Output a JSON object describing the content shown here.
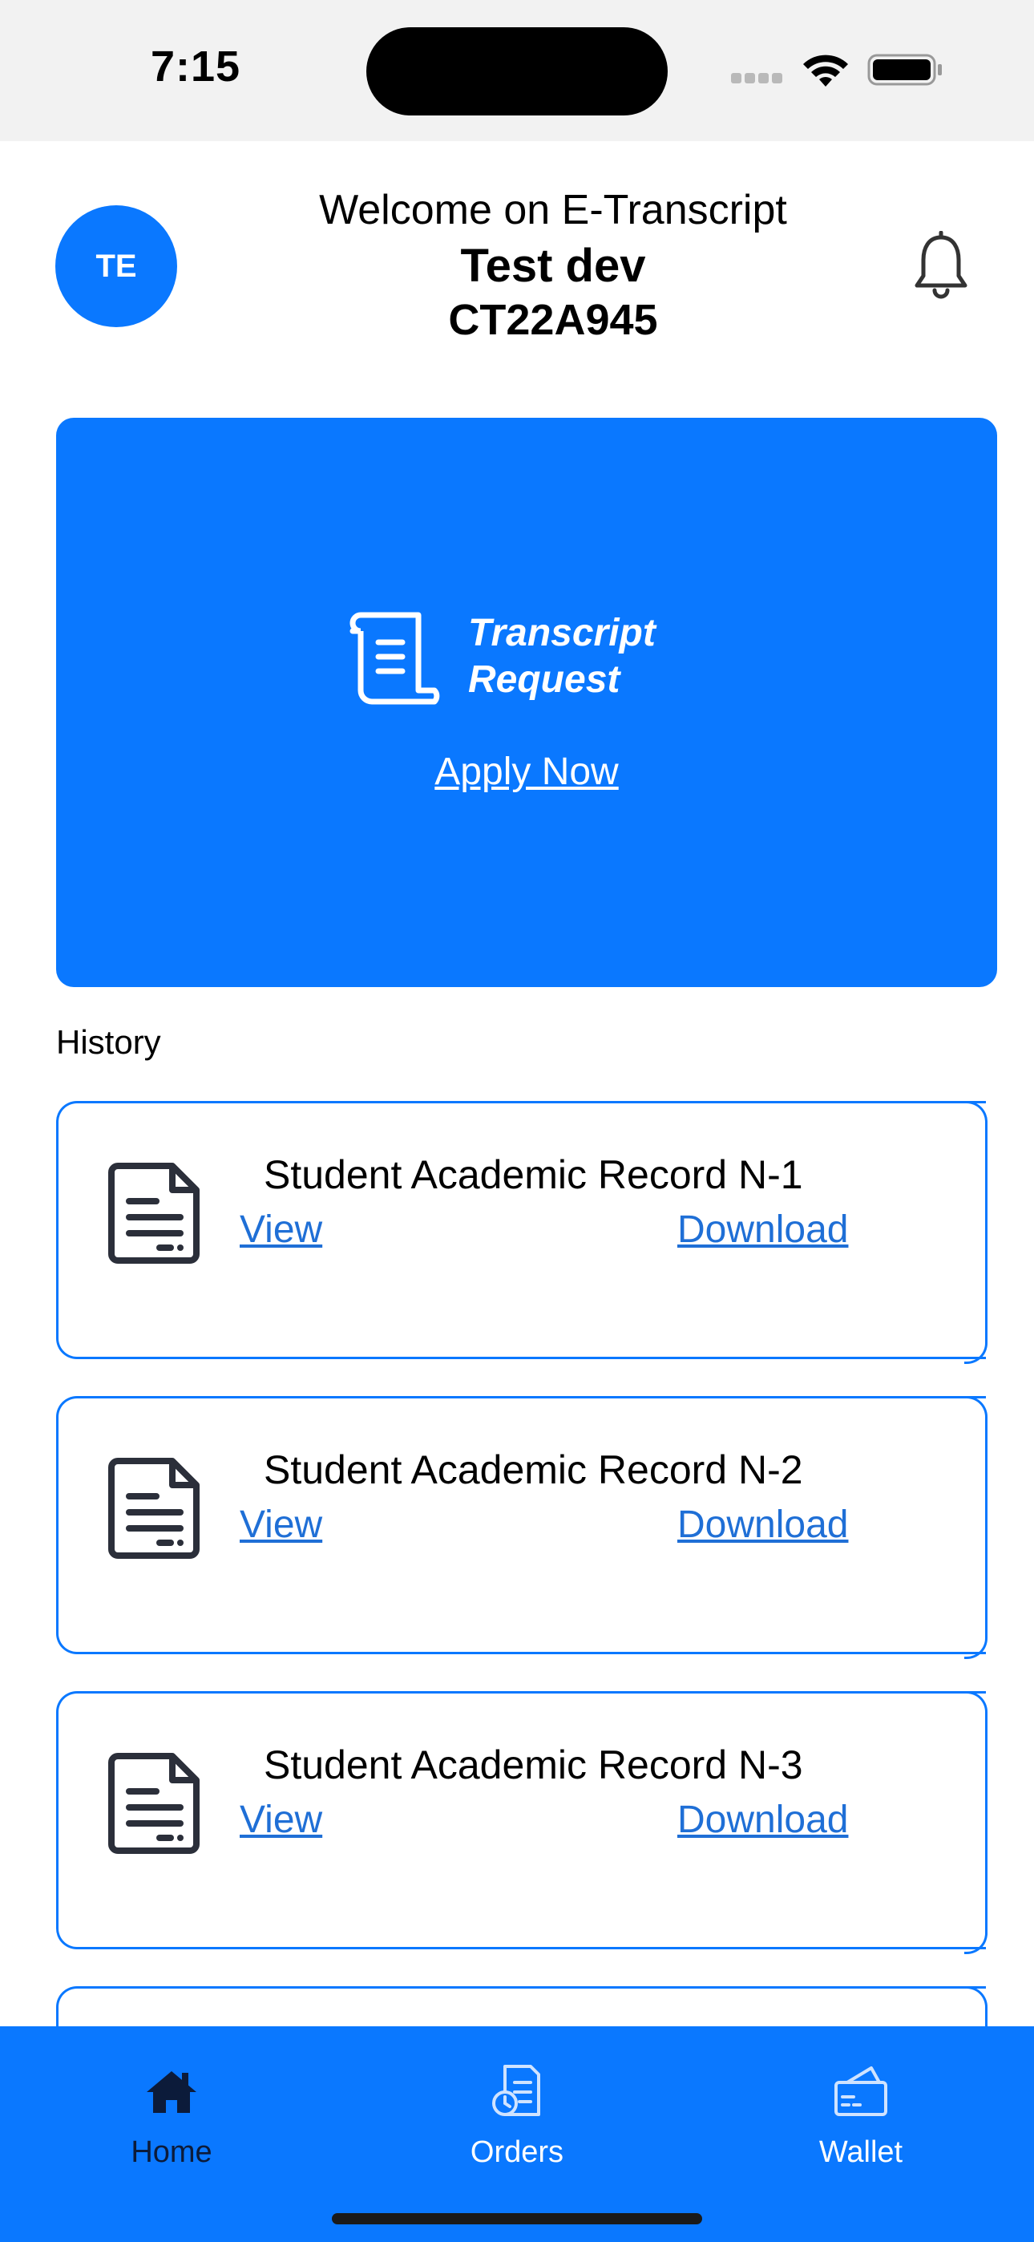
{
  "status_bar": {
    "time": "7:15"
  },
  "header": {
    "avatar_initials": "TE",
    "welcome": "Welcome on E-Transcript",
    "user_name": "Test dev",
    "user_id": "CT22A945"
  },
  "hero": {
    "title_line1": "Transcript",
    "title_line2": "Request",
    "cta": "Apply Now",
    "color": "#0a78ff"
  },
  "history": {
    "label": "History",
    "items": [
      {
        "title": "Student Academic Record N-1",
        "view": "View",
        "download": "Download"
      },
      {
        "title": "Student Academic Record N-2",
        "view": "View",
        "download": "Download"
      },
      {
        "title": "Student Academic Record N-3",
        "view": "View",
        "download": "Download"
      }
    ]
  },
  "tabbar": {
    "items": [
      {
        "label": "Home",
        "icon": "home-icon",
        "active": true
      },
      {
        "label": "Orders",
        "icon": "orders-icon",
        "active": false
      },
      {
        "label": "Wallet",
        "icon": "wallet-icon",
        "active": false
      }
    ]
  }
}
